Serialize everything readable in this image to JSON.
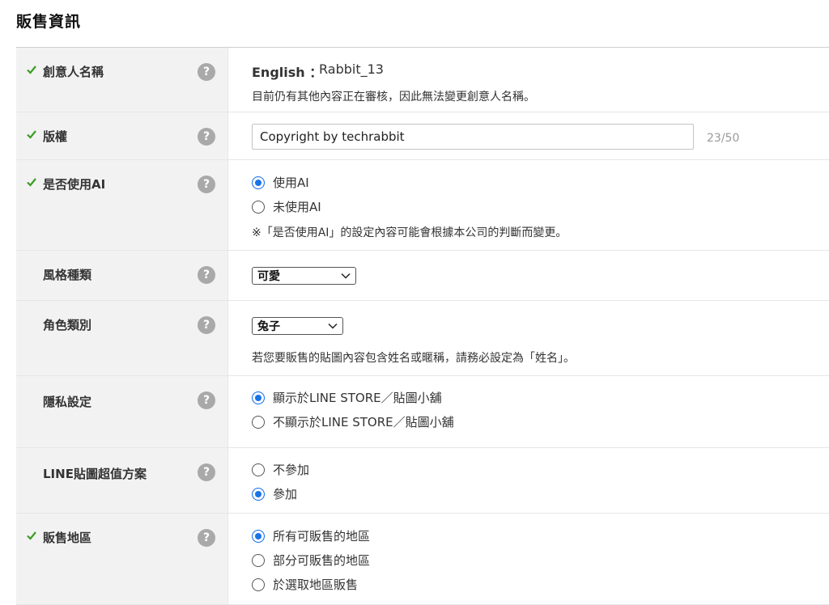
{
  "page": {
    "title": "販售資訊"
  },
  "colors": {
    "check": "#3a9d23",
    "radio_active": "#1a73e8",
    "label_bg": "#f2f2f2",
    "help_icon": "#a9a9a9"
  },
  "help_icon_glyph": "?",
  "rows": [
    {
      "key": "creator_name",
      "checked": true,
      "label": "創意人名稱",
      "language": "English",
      "separator": "：",
      "name_value": "Rabbit_13",
      "note": "目前仍有其他內容正在審核，因此無法變更創意人名稱。"
    },
    {
      "key": "copyright",
      "checked": true,
      "label": "版權",
      "input_value": "Copyright by techrabbit",
      "char_count": "23/50"
    },
    {
      "key": "use_ai",
      "checked": true,
      "label": "是否使用AI",
      "options": [
        {
          "label": "使用AI",
          "selected": true
        },
        {
          "label": "未使用AI",
          "selected": false
        }
      ],
      "note": "※「是否使用AI」的設定內容可能會根據本公司的判斷而變更。"
    },
    {
      "key": "style",
      "checked": false,
      "label": "風格種類",
      "selected_value": "可愛"
    },
    {
      "key": "character",
      "checked": false,
      "label": "角色類別",
      "selected_value": "兔子",
      "note": "若您要販售的貼圖內容包含姓名或暱稱，請務必設定為「姓名」。"
    },
    {
      "key": "privacy",
      "checked": false,
      "label": "隱私設定",
      "options": [
        {
          "label": "顯示於LINE STORE／貼圖小舖",
          "selected": true
        },
        {
          "label": "不顯示於LINE STORE／貼圖小舖",
          "selected": false
        }
      ]
    },
    {
      "key": "premium",
      "checked": false,
      "label": "LINE貼圖超值方案",
      "options": [
        {
          "label": "不參加",
          "selected": false
        },
        {
          "label": "參加",
          "selected": true
        }
      ]
    },
    {
      "key": "region",
      "checked": true,
      "label": "販售地區",
      "options": [
        {
          "label": "所有可販售的地區",
          "selected": true
        },
        {
          "label": "部分可販售的地區",
          "selected": false
        },
        {
          "label": "於選取地區販售",
          "selected": false
        }
      ]
    }
  ]
}
